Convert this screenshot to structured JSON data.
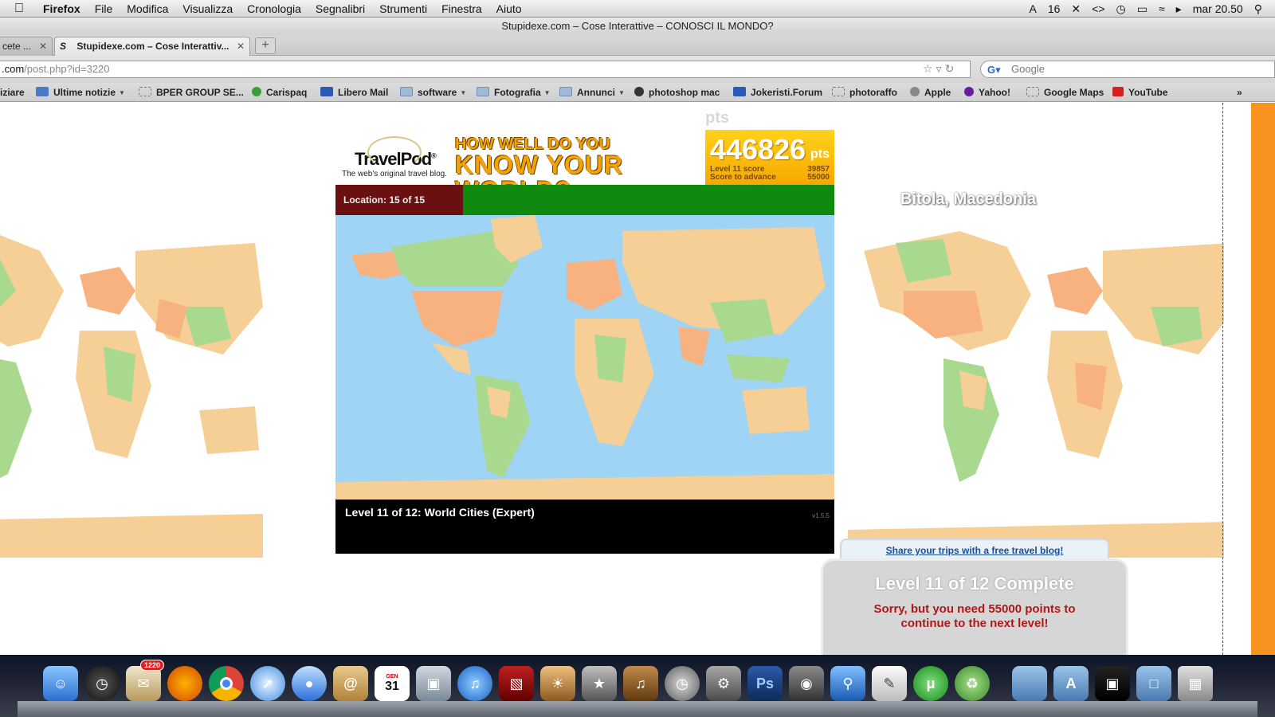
{
  "menubar": {
    "app": "Firefox",
    "items": [
      "File",
      "Modifica",
      "Visualizza",
      "Cronologia",
      "Segnalibri",
      "Strumenti",
      "Finestra",
      "Aiuto"
    ],
    "status_num": "16",
    "clock": "mar 20.50"
  },
  "window": {
    "title": "Stupidexe.com – Cose Interattive – CONOSCI IL MONDO?"
  },
  "tabs": [
    {
      "label": "cete ..."
    },
    {
      "label": "Stupidexe.com – Cose Interattiv..."
    }
  ],
  "new_tab": "+",
  "address": {
    "domain": ".com",
    "path": "/post.php?id=3220"
  },
  "search": {
    "placeholder": "Google"
  },
  "bookmarks": [
    {
      "label": "iziare"
    },
    {
      "label": "Ultime notizie"
    },
    {
      "label": "BPER GROUP SE..."
    },
    {
      "label": "Carispaq"
    },
    {
      "label": "Libero Mail"
    },
    {
      "label": "software"
    },
    {
      "label": "Fotografia"
    },
    {
      "label": "Annunci"
    },
    {
      "label": "photoshop mac"
    },
    {
      "label": "Jokeristi.Forum"
    },
    {
      "label": "photoraffo"
    },
    {
      "label": "Apple"
    },
    {
      "label": "Yahoo!"
    },
    {
      "label": "Google Maps"
    },
    {
      "label": "YouTube"
    }
  ],
  "game": {
    "pts_ghost": "pts",
    "logo_name": "TravelPod",
    "logo_reg": "®",
    "logo_tag": "The web's original travel blog.",
    "headline_1": "HOW WELL DO YOU",
    "headline_2": "KNOW YOUR WORLD?",
    "score": "446826",
    "score_unit": "pts",
    "level_score_label": "Level 11 score",
    "level_score": "39857",
    "advance_label": "Score to advance",
    "advance_score": "55000",
    "location_label": "Location: 15 of 15",
    "level_caption": "Level 11 of 12: World Cities (Expert)",
    "version": "v1.5.5"
  },
  "location_name": "Bitola, Macedonia",
  "popup": {
    "share_link": "Share your trips with a free travel blog!",
    "title": "Level 11 of 12 Complete",
    "message_1": "Sorry, but you need 55000 points to",
    "message_2": "continue to the next level!"
  },
  "dock": {
    "badge": "1220",
    "calendar_day": "31",
    "calendar_month": "GEN",
    "ps_label": "Ps"
  },
  "colors": {
    "ocean": "#9fd4f5",
    "land_orange": "#f7b27f",
    "land_green": "#a9d98f",
    "land_tan": "#f5cf95",
    "accent_orange": "#f7931e"
  }
}
